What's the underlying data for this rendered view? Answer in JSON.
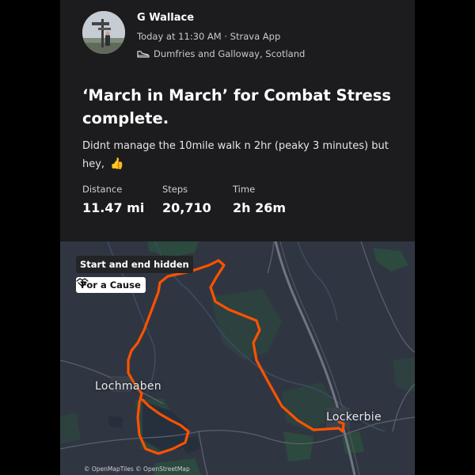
{
  "athlete": {
    "name": "G Wallace",
    "meta": "Today at 11:30 AM · Strava App",
    "location": "Dumfries and Galloway, Scotland"
  },
  "activity": {
    "title": "‘March in March’ for Combat Stress complete.",
    "description": "Didnt manage the 10mile walk n 2hr (peaky 3 minutes) but hey,",
    "emoji": "👍"
  },
  "stats": [
    {
      "label": "Distance",
      "value": "11.47 mi"
    },
    {
      "label": "Steps",
      "value": "20,710"
    },
    {
      "label": "Time",
      "value": "2h 26m"
    }
  ],
  "map": {
    "privacy_badge": "Start and end hidden",
    "cause_badge": "For a Cause",
    "places": {
      "west": "Lochmaben",
      "east": "Lockerbie"
    },
    "attribution": "© OpenMapTiles © OpenStreetMap",
    "route_color": "#fc5200",
    "background_color": "#303641"
  },
  "icons": {
    "location": "shoe-icon",
    "cause": "handshake-icon",
    "avatar": "signpost-photo"
  }
}
